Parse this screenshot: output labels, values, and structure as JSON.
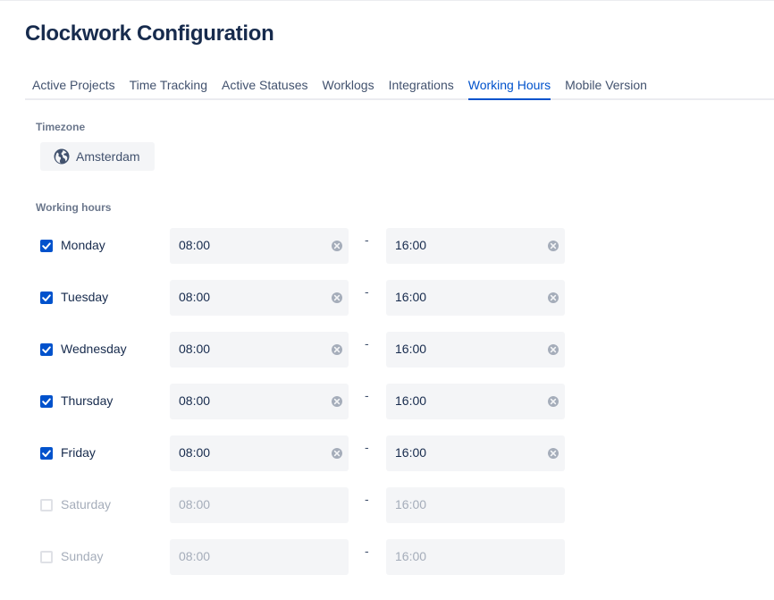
{
  "page": {
    "title": "Clockwork Configuration"
  },
  "tabs": [
    {
      "label": "Active Projects",
      "active": false
    },
    {
      "label": "Time Tracking",
      "active": false
    },
    {
      "label": "Active Statuses",
      "active": false
    },
    {
      "label": "Worklogs",
      "active": false
    },
    {
      "label": "Integrations",
      "active": false
    },
    {
      "label": "Working Hours",
      "active": true
    },
    {
      "label": "Mobile Version",
      "active": false
    }
  ],
  "timezone": {
    "section_label": "Timezone",
    "value": "Amsterdam",
    "icon": "globe-icon"
  },
  "working_hours": {
    "section_label": "Working hours",
    "separator": "-",
    "days": [
      {
        "day": "Monday",
        "enabled": true,
        "start": "08:00",
        "end": "16:00"
      },
      {
        "day": "Tuesday",
        "enabled": true,
        "start": "08:00",
        "end": "16:00"
      },
      {
        "day": "Wednesday",
        "enabled": true,
        "start": "08:00",
        "end": "16:00"
      },
      {
        "day": "Thursday",
        "enabled": true,
        "start": "08:00",
        "end": "16:00"
      },
      {
        "day": "Friday",
        "enabled": true,
        "start": "08:00",
        "end": "16:00"
      },
      {
        "day": "Saturday",
        "enabled": false,
        "start": "08:00",
        "end": "16:00"
      },
      {
        "day": "Sunday",
        "enabled": false,
        "start": "08:00",
        "end": "16:00"
      }
    ]
  },
  "colors": {
    "accent": "#0052cc",
    "text": "#172b4d",
    "disabled_text": "#a5adba",
    "field_bg": "#f4f5f7"
  }
}
